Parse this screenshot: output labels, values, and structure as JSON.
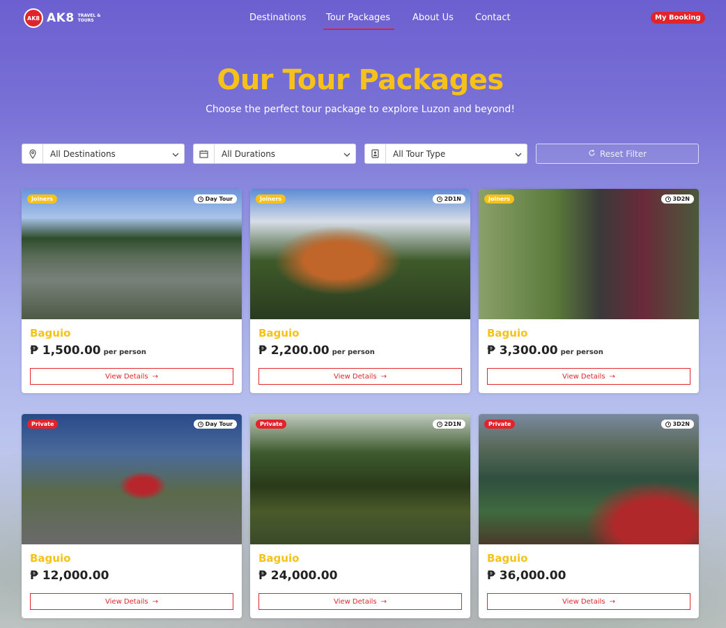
{
  "brand": {
    "logo_mark": "AK8",
    "name": "AK8",
    "tagline": "TRAVEL & TOURS"
  },
  "nav": {
    "links": [
      "Destinations",
      "Tour Packages",
      "About Us",
      "Contact"
    ],
    "active": "Tour Packages",
    "booking_label": "My Booking"
  },
  "hero": {
    "title": "Our Tour Packages",
    "subtitle": "Choose the perfect tour package to explore Luzon and beyond!"
  },
  "filters": {
    "destination": "All Destinations",
    "duration": "All Durations",
    "tour_type": "All Tour Type",
    "reset_label": "Reset Filter"
  },
  "colors": {
    "accent_yellow": "#f6c21a",
    "accent_red": "#e1232b"
  },
  "packages": [
    {
      "type": "Joiners",
      "duration": "Day Tour",
      "destination": "Baguio",
      "price": "₱ 1,500.00",
      "per": "per person",
      "cta": "View Details"
    },
    {
      "type": "Joiners",
      "duration": "2D1N",
      "destination": "Baguio",
      "price": "₱ 2,200.00",
      "per": "per person",
      "cta": "View Details"
    },
    {
      "type": "Joiners",
      "duration": "3D2N",
      "destination": "Baguio",
      "price": "₱ 3,300.00",
      "per": "per person",
      "cta": "View Details"
    },
    {
      "type": "Private",
      "duration": "Day Tour",
      "destination": "Baguio",
      "price": "₱ 12,000.00",
      "per": "",
      "cta": "View Details"
    },
    {
      "type": "Private",
      "duration": "2D1N",
      "destination": "Baguio",
      "price": "₱ 24,000.00",
      "per": "",
      "cta": "View Details"
    },
    {
      "type": "Private",
      "duration": "3D2N",
      "destination": "Baguio",
      "price": "₱ 36,000.00",
      "per": "",
      "cta": "View Details"
    }
  ]
}
